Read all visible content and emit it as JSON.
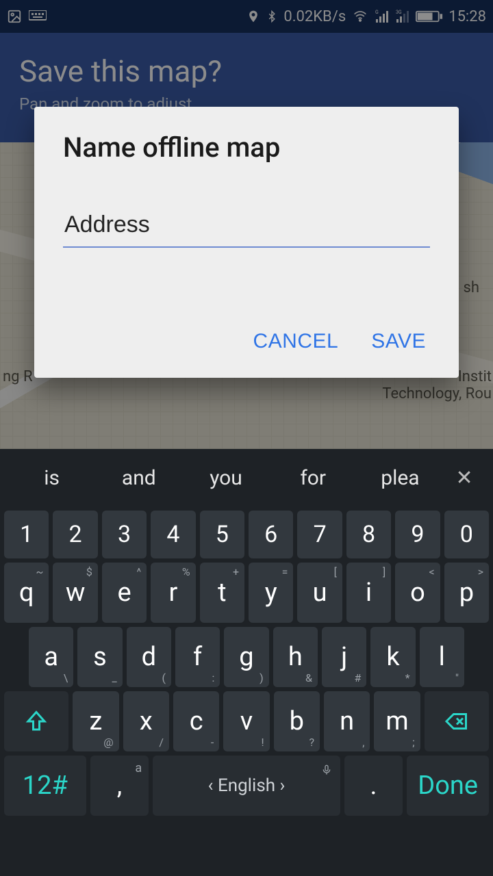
{
  "status": {
    "data_rate": "0.02KB/s",
    "time": "15:28"
  },
  "header": {
    "title": "Save this map?",
    "subtitle": "Pan and zoom to adjust"
  },
  "map_labels": {
    "left": "ng R",
    "sh": "sh",
    "inst": "Instit",
    "tech": "Technology, Rou"
  },
  "dialog": {
    "title": "Name offline map",
    "input_value": "Address",
    "cancel": "CANCEL",
    "save": "SAVE"
  },
  "keyboard": {
    "suggestions": [
      "is",
      "and",
      "you",
      "for",
      "plea"
    ],
    "row_nums": [
      "1",
      "2",
      "3",
      "4",
      "5",
      "6",
      "7",
      "8",
      "9",
      "0"
    ],
    "row_q": [
      {
        "k": "q",
        "h": "~"
      },
      {
        "k": "w",
        "h": "$"
      },
      {
        "k": "e",
        "h": "^"
      },
      {
        "k": "r",
        "h": "%"
      },
      {
        "k": "t",
        "h": "+"
      },
      {
        "k": "y",
        "h": "="
      },
      {
        "k": "u",
        "h": "["
      },
      {
        "k": "i",
        "h": "]"
      },
      {
        "k": "o",
        "h": "<"
      },
      {
        "k": "p",
        "h": ">"
      }
    ],
    "row_a": [
      {
        "k": "a",
        "s": "\\"
      },
      {
        "k": "s",
        "s": "_"
      },
      {
        "k": "d",
        "s": "("
      },
      {
        "k": "f",
        "s": ":"
      },
      {
        "k": "g",
        "s": ")"
      },
      {
        "k": "h",
        "s": "&"
      },
      {
        "k": "j",
        "s": "#"
      },
      {
        "k": "k",
        "s": "*"
      },
      {
        "k": "l",
        "s": "\""
      }
    ],
    "row_z": [
      {
        "k": "z",
        "s": "@"
      },
      {
        "k": "x",
        "s": "/"
      },
      {
        "k": "c",
        "s": "-"
      },
      {
        "k": "v",
        "s": "!"
      },
      {
        "k": "b",
        "s": "?"
      },
      {
        "k": "n",
        "s": ","
      },
      {
        "k": "m",
        "s": ";"
      }
    ],
    "symkey": "12#",
    "lang_key": ",",
    "lang_sup": "a",
    "space": "English",
    "period": ".",
    "done": "Done"
  }
}
